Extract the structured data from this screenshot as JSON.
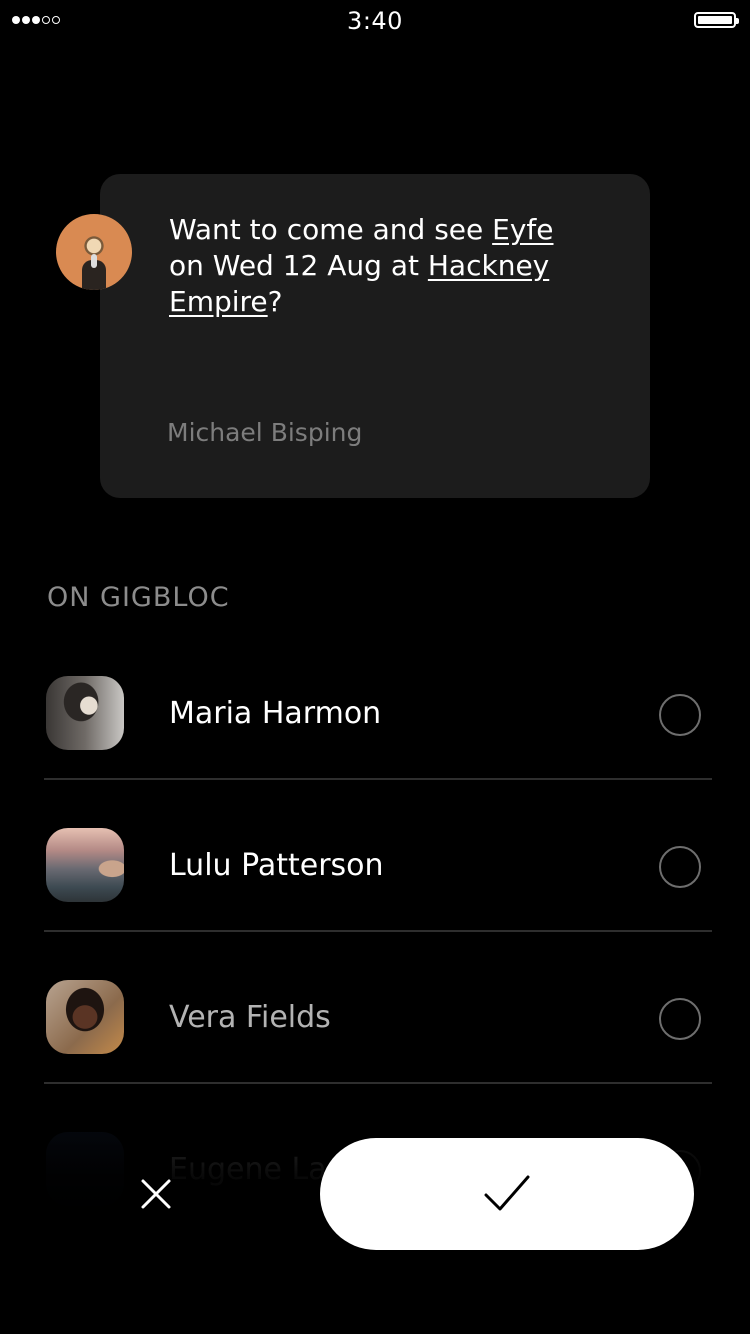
{
  "status_bar": {
    "signal_bars_filled": 3,
    "signal_bars_total": 5,
    "time": "3:40",
    "battery_level": 1.0
  },
  "invite": {
    "text_before_artist": "Want to come and see ",
    "artist": "Eyfe",
    "text_before_date": " on ",
    "date": "Wed 12 Aug",
    "text_before_venue": " at ",
    "venue": "Hackney Empire",
    "text_after_venue": "?",
    "sender_name": "Michael Bisping"
  },
  "contacts_section": {
    "heading": "ON GIGBLOC",
    "contacts": [
      {
        "name": "Maria Harmon",
        "selected": false
      },
      {
        "name": "Lulu Patterson",
        "selected": false
      },
      {
        "name": "Vera Fields",
        "selected": false
      },
      {
        "name": "Eugene La",
        "selected": false
      }
    ]
  },
  "actions": {
    "dismiss_icon": "close-icon",
    "accept_icon": "checkmark-icon"
  },
  "colors": {
    "background": "#000000",
    "card": "#1c1c1c",
    "muted_text": "#8c8c8c",
    "accept_button": "#ffffff"
  }
}
